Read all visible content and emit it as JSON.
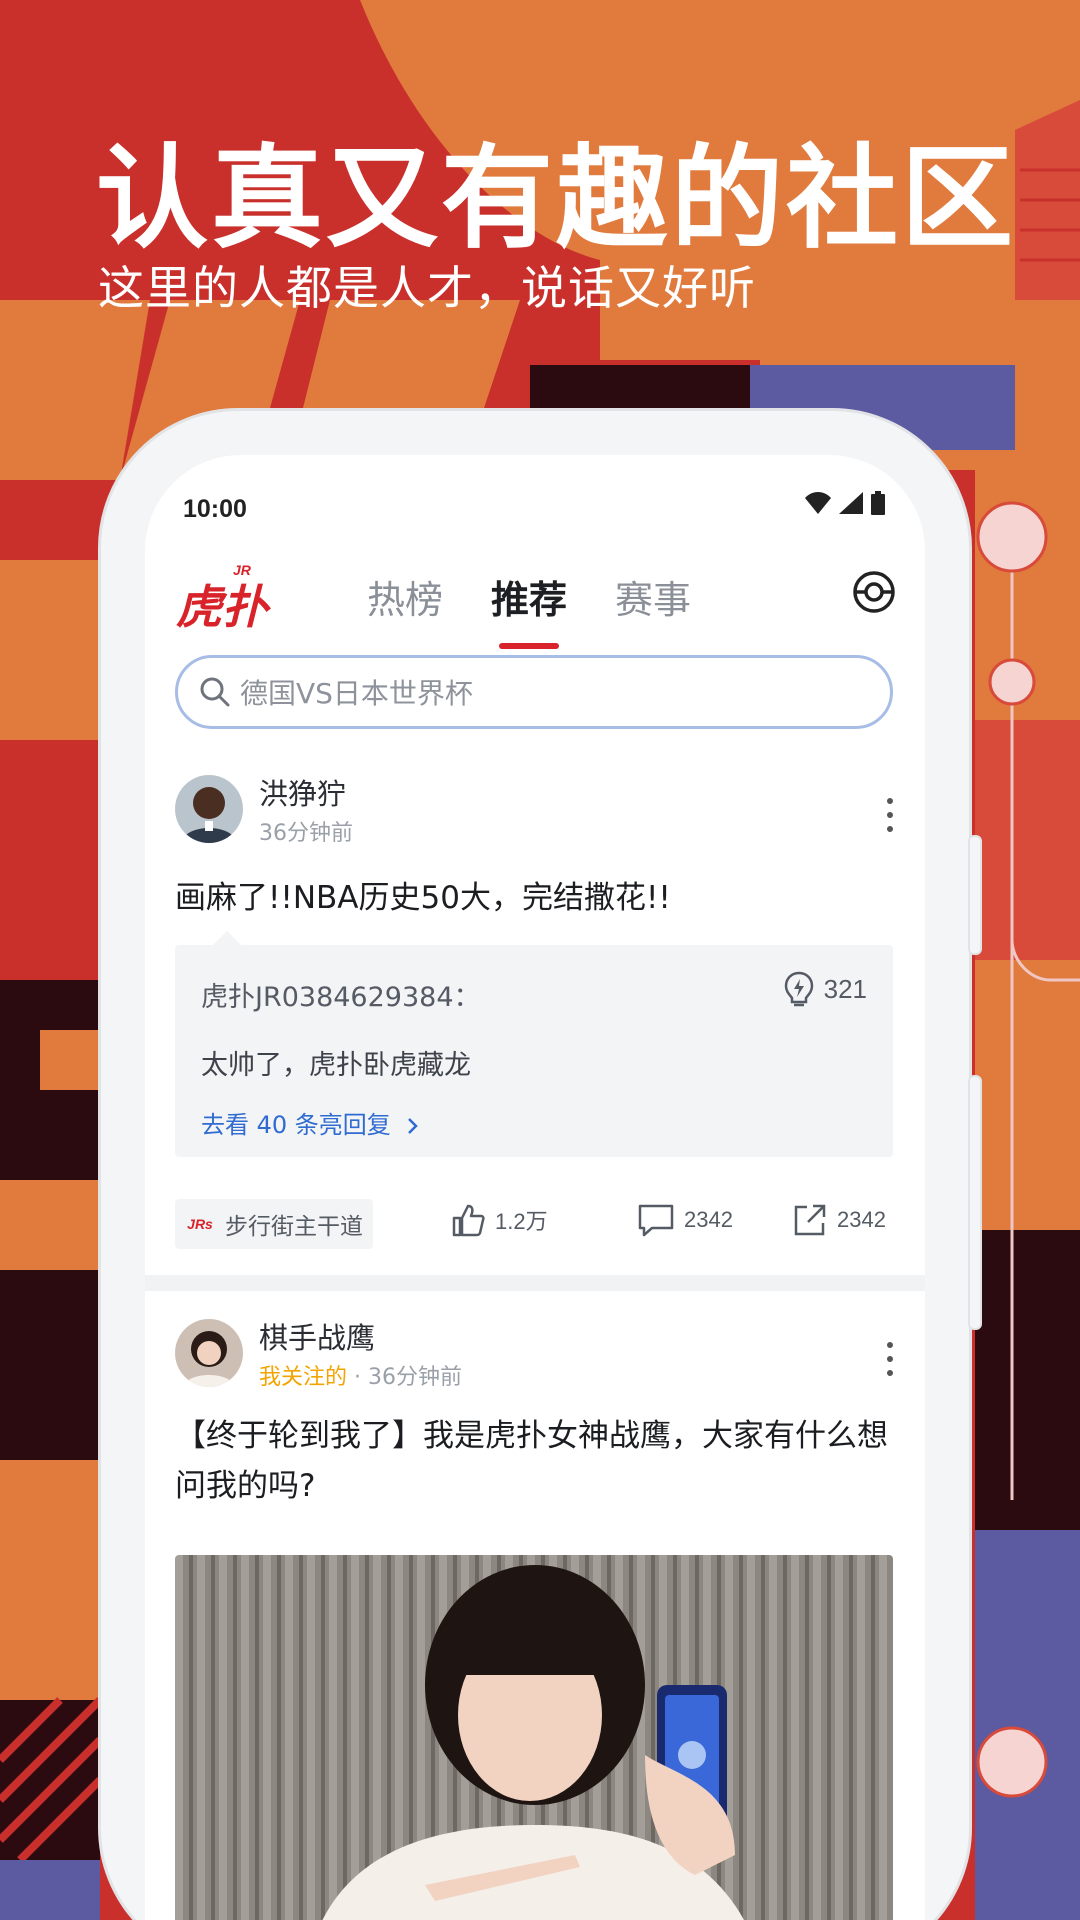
{
  "promo": {
    "headline": "认真又有趣的社区",
    "subline": "这里的人都是人才，说话又好听"
  },
  "status_bar": {
    "time": "10:00"
  },
  "app": {
    "logo_text": "虎扑",
    "logo_badge": "JR",
    "tabs": [
      "热榜",
      "推荐",
      "赛事"
    ],
    "active_tab": "推荐"
  },
  "search": {
    "placeholder": "德国VS日本世界杯"
  },
  "posts": [
    {
      "author": "洪狰狞",
      "time": "36分钟前",
      "title": "画麻了!!NBA历史50大，完结撒花!!",
      "top_reply": {
        "user": "虎扑JR0384629384：",
        "lights": "321",
        "text": "太帅了，虎扑卧虎藏龙",
        "more_link": "去看 40 条亮回复"
      },
      "board": {
        "logo": "JRs",
        "name": "步行街主干道"
      },
      "likes": "1.2万",
      "comments": "2342",
      "shares": "2342"
    },
    {
      "author": "棋手战鹰",
      "follow_label": "我关注的",
      "time": "36分钟前",
      "title": "【终于轮到我了】我是虎扑女神战鹰，大家有什么想问我的吗?"
    }
  ],
  "colors": {
    "brand_red": "#d8232a",
    "link_blue": "#2f6bd0",
    "follow_yellow": "#f2a500"
  }
}
